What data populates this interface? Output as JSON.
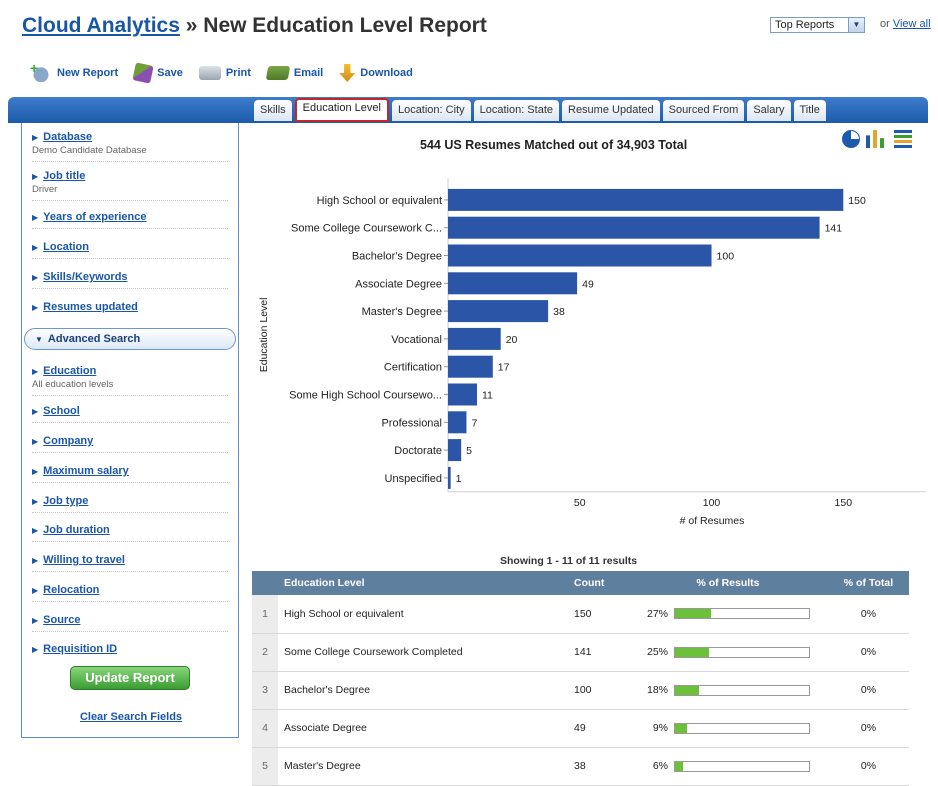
{
  "header": {
    "brand": "Cloud Analytics",
    "separator": " » ",
    "title": "New Education Level Report",
    "reports_select": "Top Reports",
    "or_text": "or ",
    "view_all": "View all"
  },
  "toolbar": {
    "new_report": "New Report",
    "save": "Save",
    "print": "Print",
    "email": "Email",
    "download": "Download"
  },
  "tabs": [
    "Skills",
    "Education Level",
    "Location: City",
    "Location: State",
    "Resume Updated",
    "Sourced From",
    "Salary",
    "Title"
  ],
  "active_tab": "Education Level",
  "sidebar": {
    "items": [
      {
        "label": "Database",
        "sub": "Demo Candidate Database"
      },
      {
        "label": "Job title",
        "sub": "Driver"
      },
      {
        "label": "Years of experience",
        "sub": ""
      },
      {
        "label": "Location",
        "sub": ""
      },
      {
        "label": "Skills/Keywords",
        "sub": ""
      },
      {
        "label": "Resumes updated",
        "sub": ""
      }
    ],
    "advanced_label": "Advanced Search",
    "advanced_items": [
      {
        "label": "Education",
        "sub": "All education levels"
      },
      {
        "label": "School",
        "sub": ""
      },
      {
        "label": "Company",
        "sub": ""
      },
      {
        "label": "Maximum salary",
        "sub": ""
      },
      {
        "label": "Job type",
        "sub": ""
      },
      {
        "label": "Job duration",
        "sub": ""
      },
      {
        "label": "Willing to travel",
        "sub": ""
      },
      {
        "label": "Relocation",
        "sub": ""
      },
      {
        "label": "Source",
        "sub": ""
      },
      {
        "label": "Requisition ID",
        "sub": ""
      }
    ],
    "update_button": "Update Report",
    "clear_link": "Clear Search Fields"
  },
  "chart_data": {
    "type": "bar",
    "orientation": "horizontal",
    "title": "544 US Resumes Matched out of 34,903 Total",
    "xlabel": "# of Resumes",
    "ylabel": "Education Level",
    "categories": [
      "High School or equivalent",
      "Some College Coursework C...",
      "Bachelor's Degree",
      "Associate Degree",
      "Master's Degree",
      "Vocational",
      "Certification",
      "Some High School Coursewo...",
      "Professional",
      "Doctorate",
      "Unspecified"
    ],
    "values": [
      150,
      141,
      100,
      49,
      38,
      20,
      17,
      11,
      7,
      5,
      1
    ],
    "xticks": [
      50,
      100,
      150
    ],
    "xlim": [
      0,
      170
    ],
    "color": "#2b55a6",
    "grid": false
  },
  "table": {
    "showing": "Showing  1 - 11  of  11  results",
    "headers": [
      "Education Level",
      "Count",
      "% of Results",
      "% of Total"
    ],
    "rows": [
      {
        "n": "1",
        "level": "High School or equivalent",
        "count": "150",
        "pct_label": "27%",
        "pct": 27,
        "total": "0%"
      },
      {
        "n": "2",
        "level": "Some College Coursework Completed",
        "count": "141",
        "pct_label": "25%",
        "pct": 25,
        "total": "0%"
      },
      {
        "n": "3",
        "level": "Bachelor's Degree",
        "count": "100",
        "pct_label": "18%",
        "pct": 18,
        "total": "0%"
      },
      {
        "n": "4",
        "level": "Associate Degree",
        "count": "49",
        "pct_label": "9%",
        "pct": 9,
        "total": "0%"
      },
      {
        "n": "5",
        "level": "Master's Degree",
        "count": "38",
        "pct_label": "6%",
        "pct": 6,
        "total": "0%"
      }
    ]
  }
}
